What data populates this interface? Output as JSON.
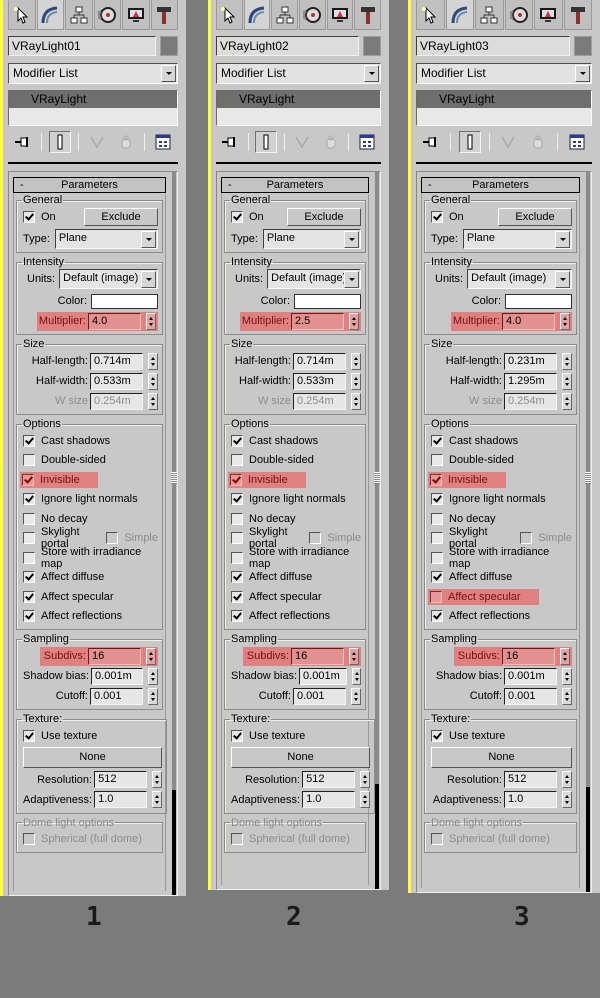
{
  "tabs": [
    {
      "name": "create",
      "icon": "create-cursor-icon"
    },
    {
      "name": "modify",
      "icon": "modify-arc-icon"
    },
    {
      "name": "hierarchy",
      "icon": "hierarchy-icon"
    },
    {
      "name": "motion",
      "icon": "motion-wheel-icon"
    },
    {
      "name": "display",
      "icon": "display-monitor-icon"
    },
    {
      "name": "utilities",
      "icon": "utilities-hammer-icon"
    }
  ],
  "common": {
    "modifier_list": "Modifier List",
    "stack_item": "VRayLight",
    "rollout_title": "Parameters",
    "rollout_toggle": "-",
    "general_label": "General",
    "on_label": "On",
    "exclude_label": "Exclude",
    "type_label": "Type:",
    "type_value": "Plane",
    "intensity_label": "Intensity",
    "units_label": "Units:",
    "units_value": "Default (image)",
    "color_label": "Color:",
    "multiplier_label": "Multiplier:",
    "size_label": "Size",
    "half_length_label": "Half-length:",
    "half_width_label": "Half-width:",
    "w_size_label": "W size",
    "options_label": "Options",
    "sampling_label": "Sampling",
    "subdivs_label": "Subdivs:",
    "shadow_bias_label": "Shadow bias:",
    "cutoff_label": "Cutoff:",
    "texture_label": "Texture:",
    "use_texture_label": "Use texture",
    "texture_map_button": "None",
    "resolution_label": "Resolution:",
    "adaptiveness_label": "Adaptiveness:",
    "dome_label": "Dome light options",
    "spherical_label": "Spherical (full dome)",
    "simple_label": "Simple",
    "highlight_color": "#eb5a5a"
  },
  "panels": [
    {
      "caption": "1",
      "object_name": "VRayLight01",
      "on": true,
      "multiplier": "4.0",
      "half_length": "0.714m",
      "half_width": "0.533m",
      "w_size": "0.254m",
      "options": [
        {
          "label": "Cast shadows",
          "checked": true,
          "highlight": false
        },
        {
          "label": "Double-sided",
          "checked": false,
          "highlight": false
        },
        {
          "label": "Invisible",
          "checked": true,
          "highlight": true
        },
        {
          "label": "Ignore light normals",
          "checked": true,
          "highlight": false
        },
        {
          "label": "No decay",
          "checked": false,
          "highlight": false
        },
        {
          "label": "Skylight portal",
          "checked": false,
          "highlight": false,
          "has_simple": true
        },
        {
          "label": "Store with irradiance map",
          "checked": false,
          "highlight": false
        },
        {
          "label": "Affect diffuse",
          "checked": true,
          "highlight": false
        },
        {
          "label": "Affect specular",
          "checked": true,
          "highlight": false
        },
        {
          "label": "Affect reflections",
          "checked": true,
          "highlight": false
        }
      ],
      "subdivs": "16",
      "shadow_bias": "0.001m",
      "cutoff": "0.001",
      "use_texture": true,
      "resolution": "512",
      "adaptiveness": "1.0",
      "spherical": false
    },
    {
      "caption": "2",
      "object_name": "VRayLight02",
      "on": true,
      "multiplier": "2.5",
      "half_length": "0.714m",
      "half_width": "0.533m",
      "w_size": "0.254m",
      "options": [
        {
          "label": "Cast shadows",
          "checked": true,
          "highlight": false
        },
        {
          "label": "Double-sided",
          "checked": false,
          "highlight": false
        },
        {
          "label": "Invisible",
          "checked": true,
          "highlight": true
        },
        {
          "label": "Ignore light normals",
          "checked": true,
          "highlight": false
        },
        {
          "label": "No decay",
          "checked": false,
          "highlight": false
        },
        {
          "label": "Skylight portal",
          "checked": false,
          "highlight": false,
          "has_simple": true
        },
        {
          "label": "Store with irradiance map",
          "checked": false,
          "highlight": false
        },
        {
          "label": "Affect diffuse",
          "checked": true,
          "highlight": false
        },
        {
          "label": "Affect specular",
          "checked": true,
          "highlight": false
        },
        {
          "label": "Affect reflections",
          "checked": true,
          "highlight": false
        }
      ],
      "subdivs": "16",
      "shadow_bias": "0.001m",
      "cutoff": "0.001",
      "use_texture": true,
      "resolution": "512",
      "adaptiveness": "1.0",
      "spherical": false
    },
    {
      "caption": "3",
      "object_name": "VRayLight03",
      "on": true,
      "multiplier": "4.0",
      "half_length": "0.231m",
      "half_width": "1.295m",
      "w_size": "0.254m",
      "options": [
        {
          "label": "Cast shadows",
          "checked": true,
          "highlight": false
        },
        {
          "label": "Double-sided",
          "checked": false,
          "highlight": false
        },
        {
          "label": "Invisible",
          "checked": true,
          "highlight": true
        },
        {
          "label": "Ignore light normals",
          "checked": true,
          "highlight": false
        },
        {
          "label": "No decay",
          "checked": false,
          "highlight": false
        },
        {
          "label": "Skylight portal",
          "checked": false,
          "highlight": false,
          "has_simple": true
        },
        {
          "label": "Store with irradiance map",
          "checked": false,
          "highlight": false
        },
        {
          "label": "Affect diffuse",
          "checked": true,
          "highlight": false
        },
        {
          "label": "Affect specular",
          "checked": false,
          "highlight": true
        },
        {
          "label": "Affect reflections",
          "checked": true,
          "highlight": false
        }
      ],
      "subdivs": "16",
      "shadow_bias": "0.001m",
      "cutoff": "0.001",
      "use_texture": true,
      "resolution": "512",
      "adaptiveness": "1.0",
      "spherical": false
    }
  ]
}
